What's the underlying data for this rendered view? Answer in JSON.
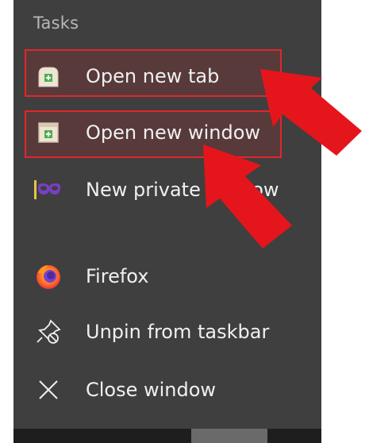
{
  "menu": {
    "section_title": "Tasks",
    "items": [
      {
        "label": "Open new tab",
        "icon": "new-tab-icon",
        "highlighted": true
      },
      {
        "label": "Open new window",
        "icon": "new-window-icon",
        "highlighted": true
      },
      {
        "label": "New private window",
        "icon": "private-mask-icon",
        "highlighted": false
      },
      {
        "label": "Firefox",
        "icon": "firefox-icon",
        "highlighted": false
      },
      {
        "label": "Unpin from taskbar",
        "icon": "unpin-icon",
        "highlighted": false
      },
      {
        "label": "Close window",
        "icon": "close-icon",
        "highlighted": false
      }
    ]
  },
  "colors": {
    "menu_background": "#3f3f3f",
    "highlight_border": "#e2262b",
    "annotation_arrow": "#e5151c",
    "text": "#f0f0f0"
  }
}
